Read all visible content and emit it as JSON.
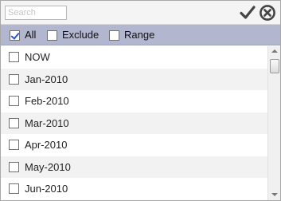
{
  "search": {
    "placeholder": "Search",
    "value": ""
  },
  "toolbar": {
    "apply_icon": "checkmark-icon",
    "close_icon": "close-circle-icon"
  },
  "options": [
    {
      "label": "All",
      "checked": true
    },
    {
      "label": "Exclude",
      "checked": false
    },
    {
      "label": "Range",
      "checked": false
    }
  ],
  "items": [
    {
      "label": "NOW",
      "checked": false
    },
    {
      "label": "Jan-2010",
      "checked": false
    },
    {
      "label": "Feb-2010",
      "checked": false
    },
    {
      "label": "Mar-2010",
      "checked": false
    },
    {
      "label": "Apr-2010",
      "checked": false
    },
    {
      "label": "May-2010",
      "checked": false
    },
    {
      "label": "Jun-2010",
      "checked": false
    }
  ],
  "colors": {
    "option_bar": "#b2b6cf",
    "row_alt": "#f2f2f2",
    "icon": "#444444"
  }
}
